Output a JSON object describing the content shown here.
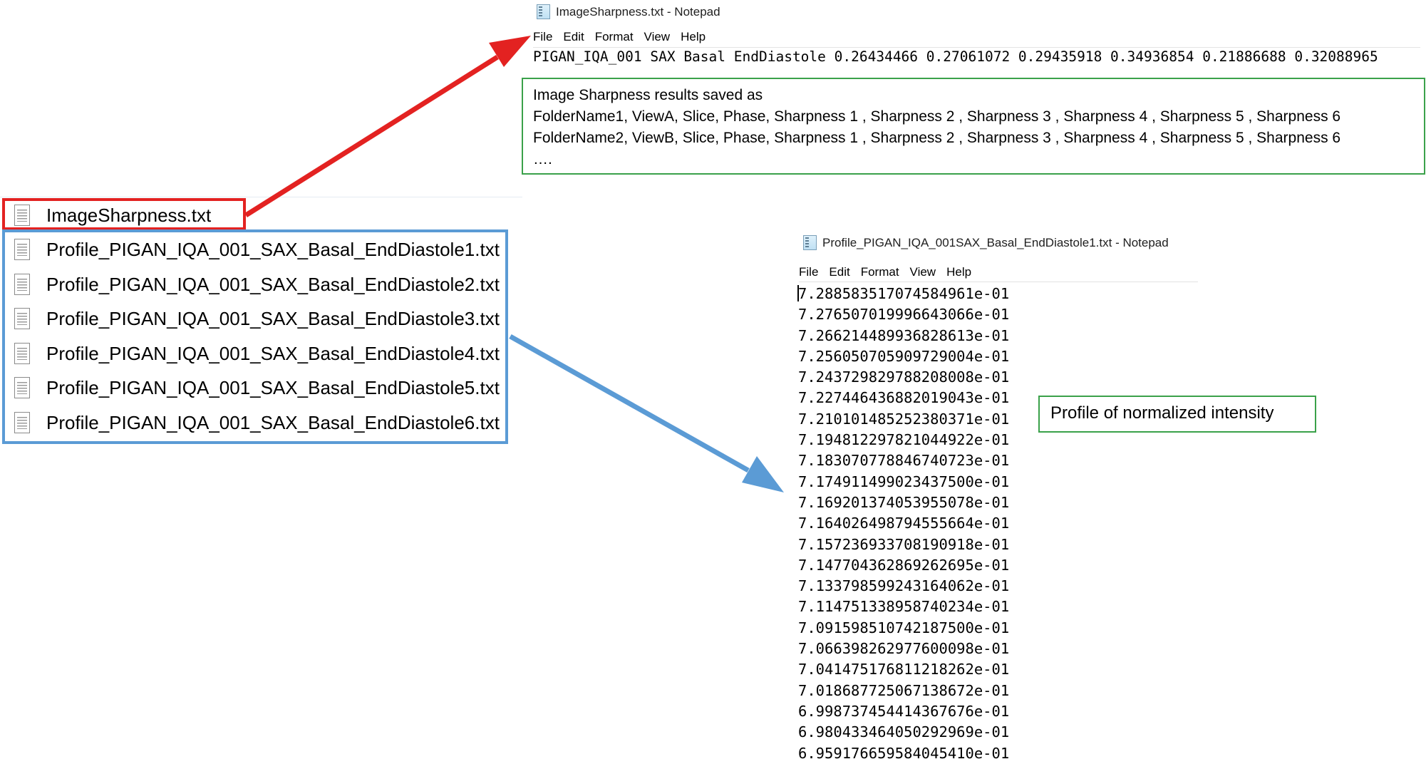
{
  "sharpness_window": {
    "title": "ImageSharpness.txt - Notepad",
    "menu": [
      "File",
      "Edit",
      "Format",
      "View",
      "Help"
    ],
    "content": "PIGAN_IQA_001 SAX Basal EndDiastole 0.26434466 0.27061072 0.29435918 0.34936854 0.21886688 0.32088965"
  },
  "sharpness_note": {
    "lines": [
      "Image Sharpness results saved as",
      "FolderName1, ViewA, Slice, Phase, Sharpness 1 , Sharpness 2 , Sharpness 3 , Sharpness 4 , Sharpness 5 , Sharpness 6",
      "FolderName2, ViewB, Slice, Phase, Sharpness 1 , Sharpness 2 , Sharpness 3 , Sharpness 4 , Sharpness 5 , Sharpness 6",
      "…."
    ]
  },
  "file_list": {
    "files": [
      "ImageSharpness.txt",
      "Profile_PIGAN_IQA_001_SAX_Basal_EndDiastole1.txt",
      "Profile_PIGAN_IQA_001_SAX_Basal_EndDiastole2.txt",
      "Profile_PIGAN_IQA_001_SAX_Basal_EndDiastole3.txt",
      "Profile_PIGAN_IQA_001_SAX_Basal_EndDiastole4.txt",
      "Profile_PIGAN_IQA_001_SAX_Basal_EndDiastole5.txt",
      "Profile_PIGAN_IQA_001_SAX_Basal_EndDiastole6.txt"
    ]
  },
  "profile_window": {
    "title": "Profile_PIGAN_IQA_001SAX_Basal_EndDiastole1.txt - Notepad",
    "menu": [
      "File",
      "Edit",
      "Format",
      "View",
      "Help"
    ],
    "values": [
      "7.288583517074584961e-01",
      "7.276507019996643066e-01",
      "7.266214489936828613e-01",
      "7.256050705909729004e-01",
      "7.243729829788208008e-01",
      "7.227446436882019043e-01",
      "7.210101485252380371e-01",
      "7.194812297821044922e-01",
      "7.183070778846740723e-01",
      "7.174911499023437500e-01",
      "7.169201374053955078e-01",
      "7.164026498794555664e-01",
      "7.157236933708190918e-01",
      "7.147704362869262695e-01",
      "7.133798599243164062e-01",
      "7.114751338958740234e-01",
      "7.091598510742187500e-01",
      "7.066398262977600098e-01",
      "7.041475176811218262e-01",
      "7.018687725067138672e-01",
      "6.998737454414367676e-01",
      "6.980433464050292969e-01",
      "6.959176659584045410e-01"
    ]
  },
  "profile_note": {
    "text": "Profile of normalized intensity"
  },
  "colors": {
    "red_arrow": "#e32221",
    "blue_arrow": "#5b9bd5",
    "green_box": "#3aa14a"
  }
}
